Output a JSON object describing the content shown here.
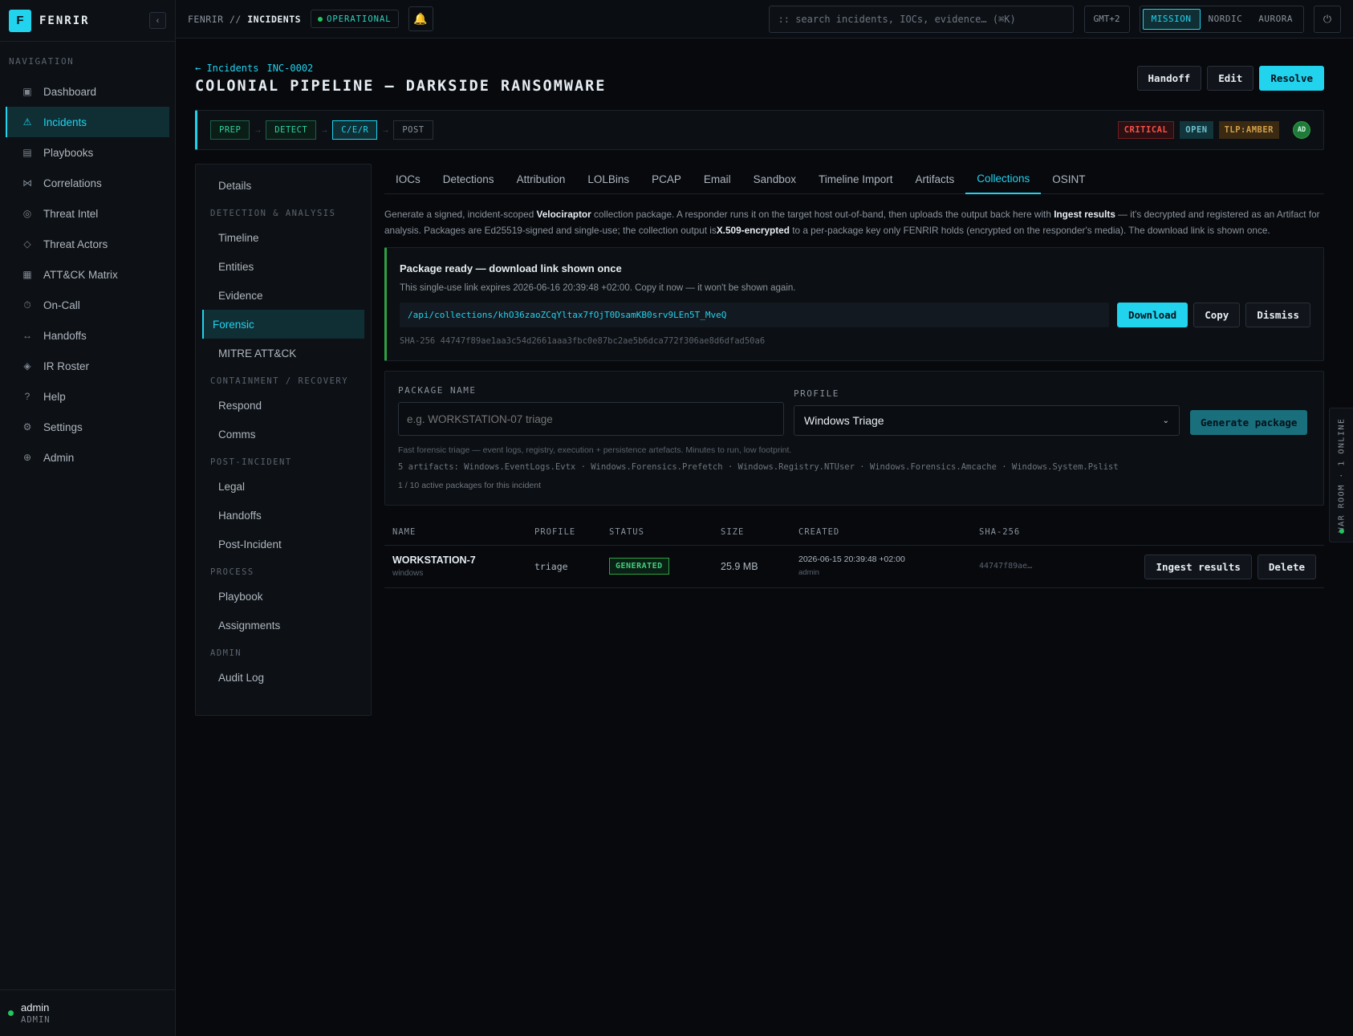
{
  "brand": {
    "logo": "F",
    "name": "FENRIR",
    "collapse": "‹"
  },
  "sidebar": {
    "title": "NAVIGATION",
    "items": [
      {
        "icon": "▣",
        "label": "Dashboard"
      },
      {
        "icon": "⚠",
        "label": "Incidents"
      },
      {
        "icon": "▤",
        "label": "Playbooks"
      },
      {
        "icon": "⋈",
        "label": "Correlations"
      },
      {
        "icon": "◎",
        "label": "Threat Intel"
      },
      {
        "icon": "◇",
        "label": "Threat Actors"
      },
      {
        "icon": "▦",
        "label": "ATT&CK Matrix"
      },
      {
        "icon": "⏱",
        "label": "On-Call"
      },
      {
        "icon": "↔",
        "label": "Handoffs"
      },
      {
        "icon": "◈",
        "label": "IR Roster"
      },
      {
        "icon": "?",
        "label": "Help"
      },
      {
        "icon": "⚙",
        "label": "Settings"
      },
      {
        "icon": "⊕",
        "label": "Admin"
      }
    ],
    "active_index": 1,
    "user": {
      "name": "admin",
      "role": "ADMIN"
    }
  },
  "topbar": {
    "crumb_root": "FENRIR // ",
    "crumb_current": "INCIDENTS",
    "status": "OPERATIONAL",
    "bell": "🔔",
    "search_placeholder": ":: search incidents, IOCs, evidence… (⌘K)",
    "timezone": "GMT+2",
    "themes": [
      "MISSION",
      "NORDIC",
      "AURORA"
    ],
    "power": "⏻"
  },
  "incident": {
    "back_label": "← Incidents",
    "id": "INC-0002",
    "title": "COLONIAL PIPELINE — DARKSIDE RANSOMWARE",
    "actions": {
      "handoff": "Handoff",
      "edit": "Edit",
      "resolve": "Resolve"
    },
    "phases": [
      "PREP",
      "DETECT",
      "C/E/R",
      "POST"
    ],
    "arrow": "→",
    "tags": {
      "severity": "CRITICAL",
      "state": "OPEN",
      "tlp": "TLP:AMBER"
    },
    "assignee_initials": "AD"
  },
  "subnav": {
    "top": "Details",
    "sections": [
      {
        "title": "DETECTION & ANALYSIS",
        "items": [
          "Timeline",
          "Entities",
          "Evidence",
          "Forensic",
          "MITRE ATT&CK"
        ]
      },
      {
        "title": "CONTAINMENT / RECOVERY",
        "items": [
          "Respond",
          "Comms"
        ]
      },
      {
        "title": "POST-INCIDENT",
        "items": [
          "Legal",
          "Handoffs",
          "Post-Incident"
        ]
      },
      {
        "title": "PROCESS",
        "items": [
          "Playbook",
          "Assignments"
        ]
      },
      {
        "title": "ADMIN",
        "items": [
          "Audit Log"
        ]
      }
    ],
    "active": "Forensic"
  },
  "tabs": {
    "items": [
      "IOCs",
      "Detections",
      "Attribution",
      "LOLBins",
      "PCAP",
      "Email",
      "Sandbox",
      "Timeline Import",
      "Artifacts",
      "Collections",
      "OSINT"
    ],
    "active": "Collections"
  },
  "description": {
    "p1": "Generate a signed, incident-scoped ",
    "b1": "Velociraptor",
    "p2": " collection package. A responder runs it on the target host out-of-band, then uploads the output back here with ",
    "b2": "Ingest results",
    "p3": " — it's decrypted and registered as an Artifact for analysis. Packages are Ed25519-signed and single-use; the collection output is",
    "b3": "X.509-encrypted",
    "p4": " to a per-package key only FENRIR holds (encrypted on the responder's media). The download link is shown once."
  },
  "ready": {
    "title": "Package ready — download link shown once",
    "subtitle": "This single-use link expires 2026-06-16 20:39:48 +02:00. Copy it now — it won't be shown again.",
    "url": "/api/collections/khO36zaoZCqYltax7fOjT0DsamKB0srv9LEn5T_MveQ",
    "download": "Download",
    "copy": "Copy",
    "dismiss": "Dismiss",
    "sha": "SHA-256 44747f89ae1aa3c54d2661aaa3fbc0e87bc2ae5b6dca772f306ae8d6dfad50a6"
  },
  "generator": {
    "name_label": "PACKAGE NAME",
    "name_placeholder": "e.g. WORKSTATION-07 triage",
    "profile_label": "PROFILE",
    "profile_value": "Windows Triage",
    "chevron": "⌄",
    "generate": "Generate package",
    "note": "Fast forensic triage — event logs, registry, execution + persistence artefacts. Minutes to run, low footprint.",
    "artifacts": "5 artifacts: Windows.EventLogs.Evtx · Windows.Forensics.Prefetch · Windows.Registry.NTUser · Windows.Forensics.Amcache · Windows.System.Pslist",
    "count": "1 / 10 active packages for this incident"
  },
  "table": {
    "headers": {
      "name": "NAME",
      "profile": "PROFILE",
      "status": "STATUS",
      "size": "SIZE",
      "created": "CREATED",
      "sha": "SHA-256"
    },
    "rows": [
      {
        "name": "WORKSTATION-7",
        "os": "windows",
        "profile": "triage",
        "status": "GENERATED",
        "size": "25.9 MB",
        "created": "2026-06-15 20:39:48 +02:00",
        "created_by": "admin",
        "sha": "44747f89ae…",
        "ingest": "Ingest results",
        "delete": "Delete"
      }
    ]
  },
  "warroom": {
    "label": "WAR ROOM · 1 ONLINE"
  }
}
